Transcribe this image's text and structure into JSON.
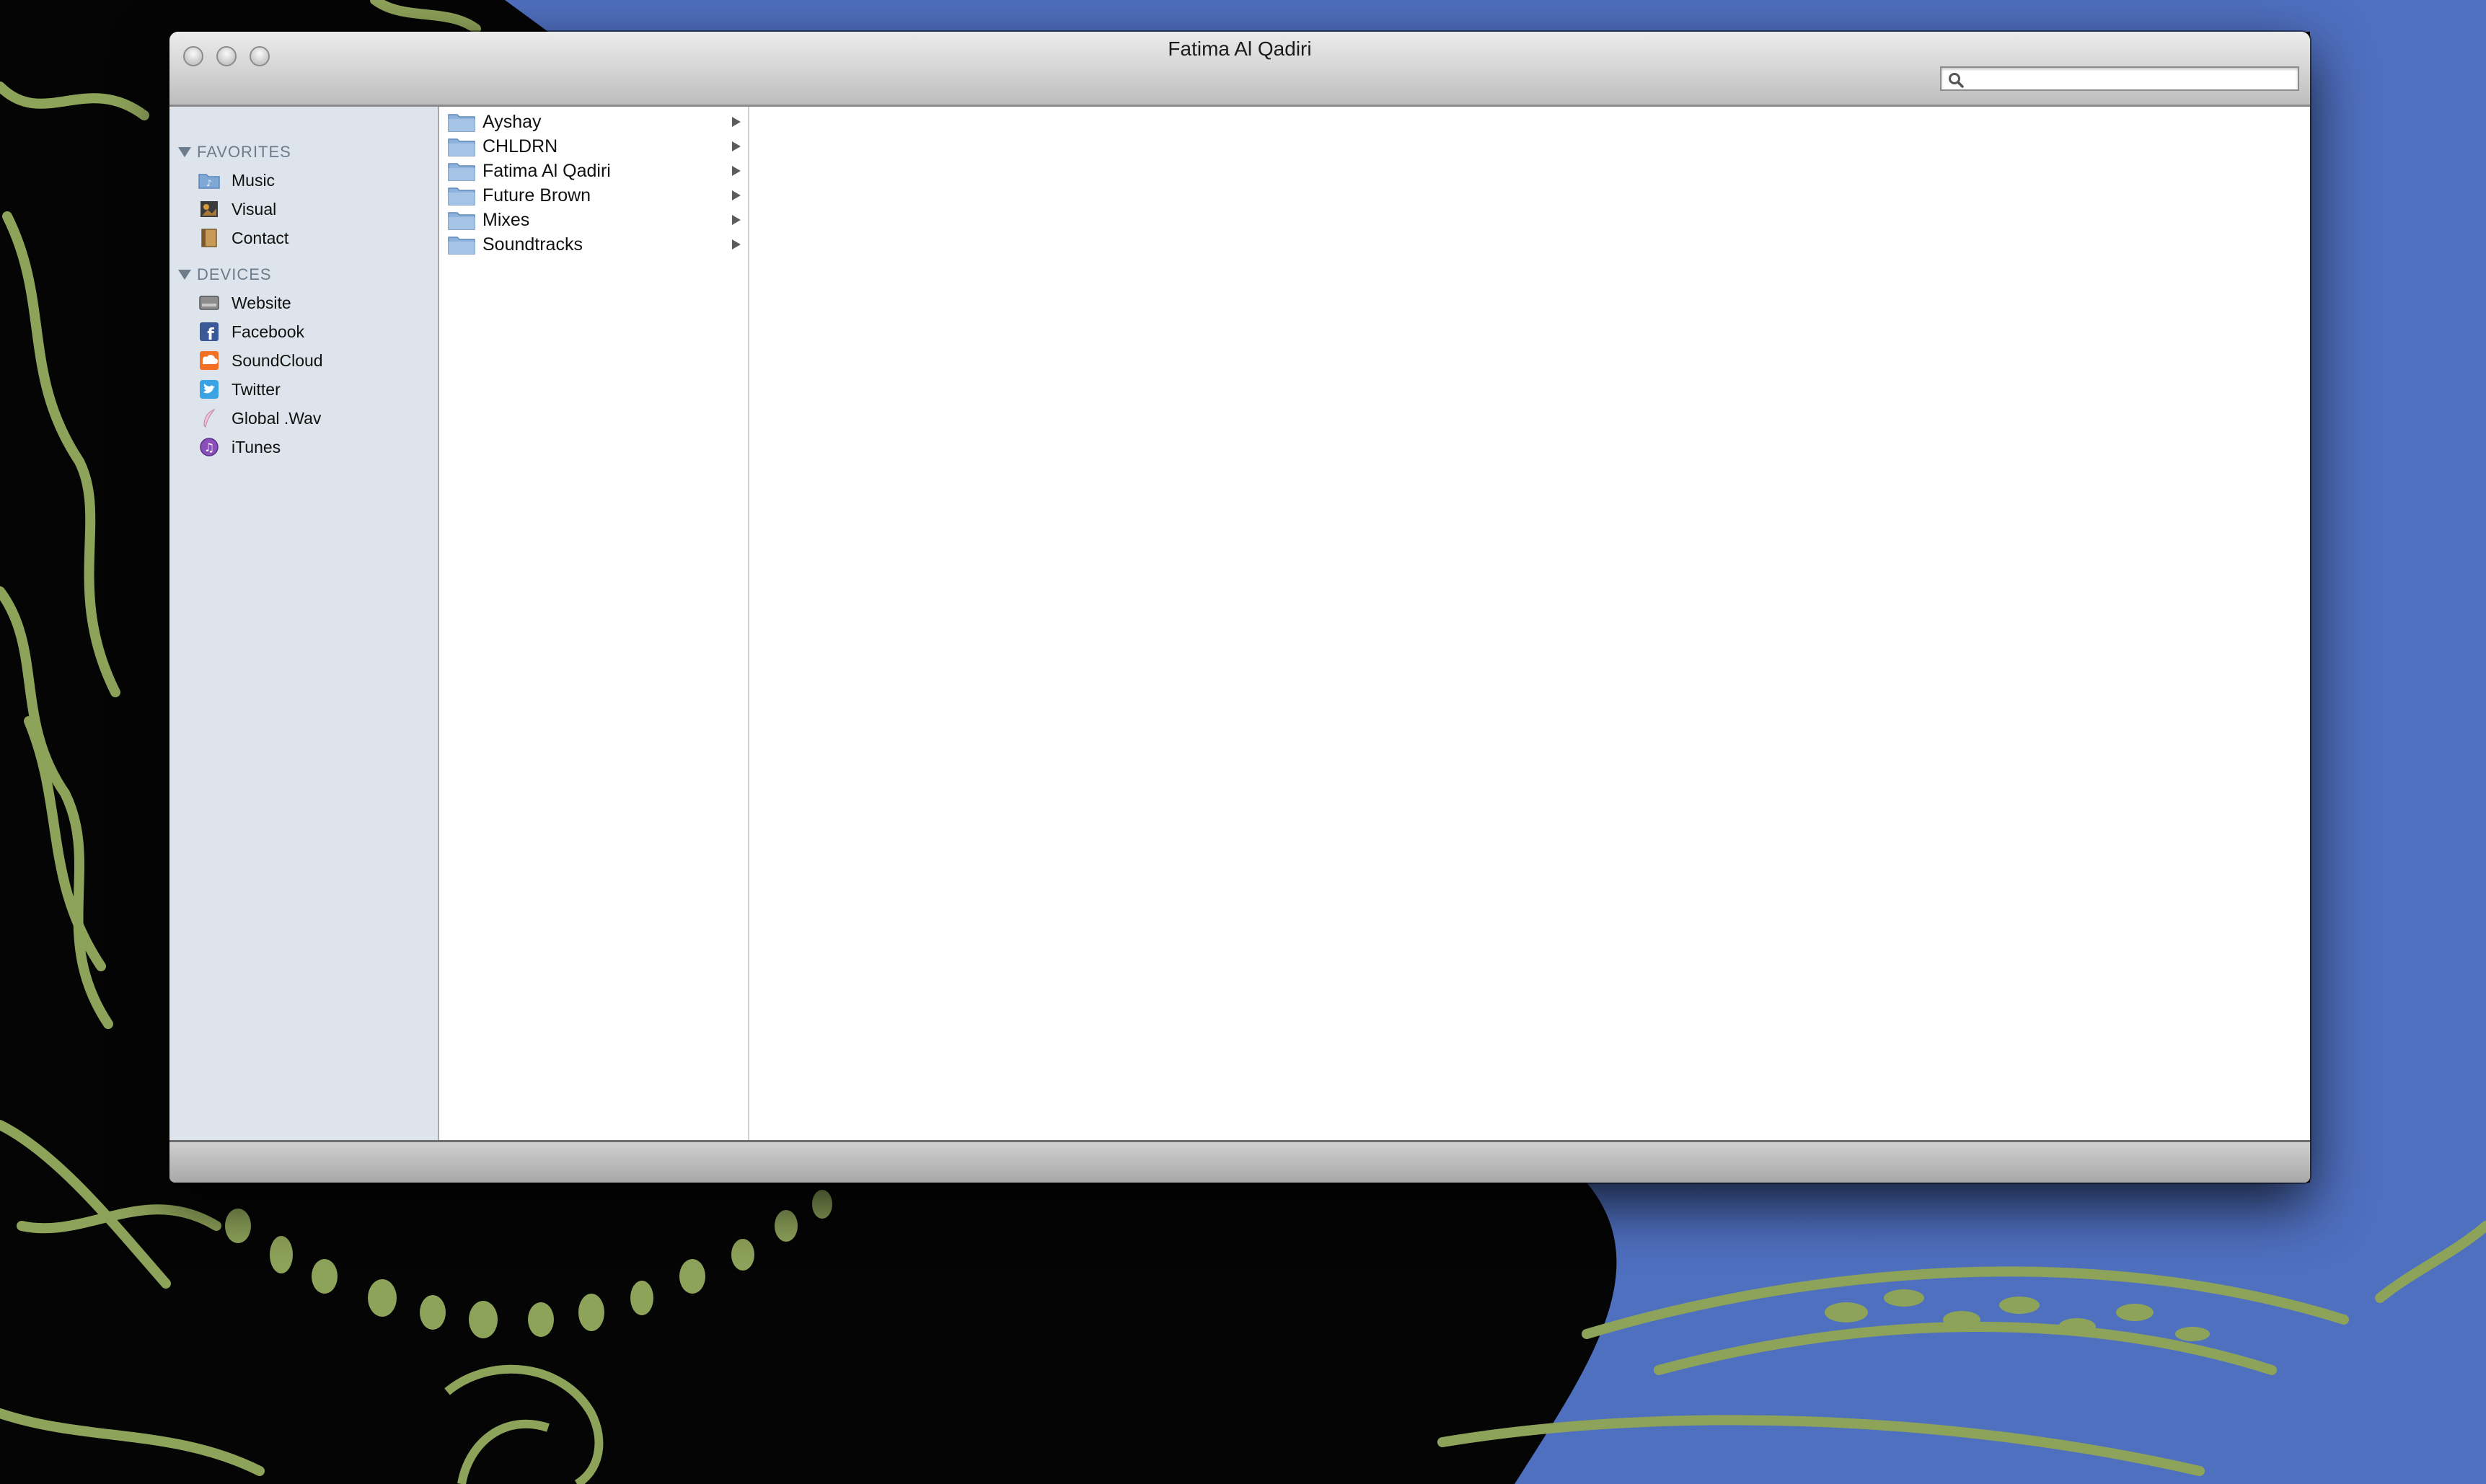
{
  "window": {
    "title": "Fatima Al Qadiri"
  },
  "search": {
    "placeholder": "",
    "value": ""
  },
  "sidebar": {
    "favorites_header": "FAVORITES",
    "favorites": [
      {
        "label": "Music",
        "icon": "music-folder-icon"
      },
      {
        "label": "Visual",
        "icon": "photo-icon"
      },
      {
        "label": "Contact",
        "icon": "address-book-icon"
      }
    ],
    "devices_header": "DEVICES",
    "devices": [
      {
        "label": "Website",
        "icon": "hard-drive-icon"
      },
      {
        "label": "Facebook",
        "icon": "facebook-icon"
      },
      {
        "label": "SoundCloud",
        "icon": "soundcloud-icon"
      },
      {
        "label": "Twitter",
        "icon": "twitter-icon"
      },
      {
        "label": "Global .Wav",
        "icon": "feather-icon"
      },
      {
        "label": "iTunes",
        "icon": "itunes-icon"
      }
    ]
  },
  "column1": {
    "items": [
      {
        "label": "Ayshay"
      },
      {
        "label": "CHLDRN"
      },
      {
        "label": "Fatima Al Qadiri"
      },
      {
        "label": "Future Brown"
      },
      {
        "label": "Mixes"
      },
      {
        "label": "Soundtracks"
      }
    ]
  },
  "colors": {
    "desktop_blue": "#4f6fbf",
    "desktop_black": "#050505",
    "desktop_green": "#8ea35a",
    "sidebar_bg": "#dde4eb"
  }
}
